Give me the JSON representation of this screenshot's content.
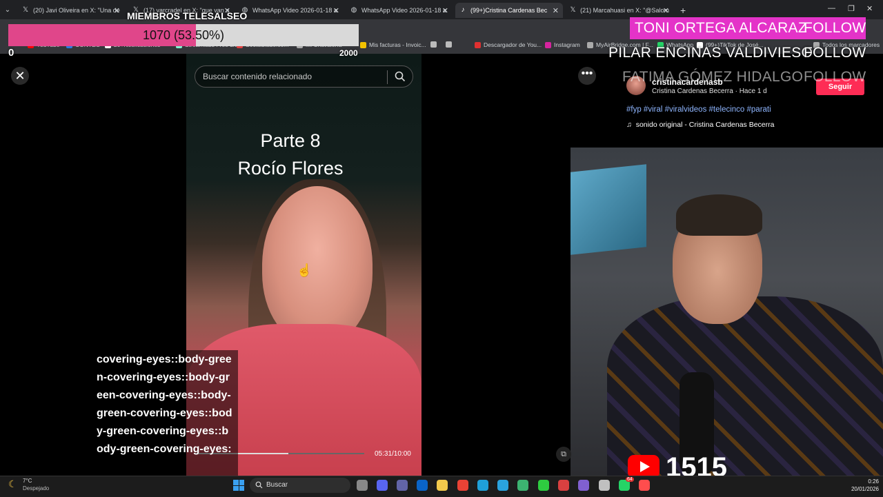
{
  "browser": {
    "tabs": [
      {
        "label": "(20) Javi Oliveira en X: \"Una de",
        "icon": "x-icon",
        "active": false
      },
      {
        "label": "(17) varcradel en X: \"que van a",
        "icon": "x-icon",
        "active": false
      },
      {
        "label": "WhatsApp Video 2026-01-18 a",
        "icon": "globe-icon",
        "active": false
      },
      {
        "label": "WhatsApp Video 2026-01-18 a",
        "icon": "globe-icon",
        "active": false
      },
      {
        "label": "(99+)Cristina Cardenas Bec",
        "icon": "tiktok-icon",
        "active": true
      },
      {
        "label": "(21) Marcahuasi en X: \"@Salom",
        "icon": "x-icon",
        "active": false
      }
    ],
    "new_tab": "+",
    "bookmarks": [
      {
        "label": "YouTube",
        "color": "#ff0000"
      },
      {
        "label": "CONTEO",
        "color": "#2a7ae2"
      },
      {
        "label": "20+Notificaciones",
        "color": "#ffffff"
      },
      {
        "label": "Streamlabs Free Liv...",
        "color": "#80f5d2"
      },
      {
        "label": "Socialblade.com",
        "color": "#e04040"
      },
      {
        "label": "Mi Chavalería",
        "color": "#aaaaaa"
      },
      {
        "label": "Mis facturas - Invoic...",
        "color": "#f2c200"
      },
      {
        "label": "",
        "color": "#bbbbbb"
      },
      {
        "label": "",
        "color": "#bbbbbb"
      },
      {
        "label": "Descargador de You...",
        "color": "#e03030"
      },
      {
        "label": "Instagram",
        "color": "#d6249f"
      },
      {
        "label": "MyAirBridge.com | F...",
        "color": "#aaaaaa"
      },
      {
        "label": "WhatsApp",
        "color": "#25d366"
      },
      {
        "label": "(99+)TikTok de José...",
        "color": "#ffffff"
      },
      {
        "label": "Todos los marcadores",
        "color": "#aaaaaa"
      }
    ]
  },
  "overlay": {
    "members_title": "MIEMBROS TELESALSEO",
    "goal_text": "1070 (53.50%)",
    "goal_fraction": 0.535,
    "goal_min": "0",
    "goal_max": "2000",
    "follows": [
      {
        "name": "TONI ORTEGA ALCARAZ",
        "action": "FOLLOW"
      },
      {
        "name": "PILAR ENCINAS VALDIVIESO",
        "action": "FOLLOW"
      },
      {
        "name": "FATIMA GÓMEZ HIDALGO",
        "action": "FOLLOW"
      }
    ],
    "chat_text": "covering-eyes::body-green-covering-eyes::body-green-covering-eyes::body-green-covering-eyes::body-green-covering-eyes::body-green-covering-eyes:",
    "youtube_count": "1515"
  },
  "tiktok": {
    "search_placeholder": "Buscar contenido relacionado",
    "caption_line1": "Parte 8",
    "caption_line2": "Rocío Flores",
    "timecode": "05:31/10:00",
    "progress_fraction": 0.553,
    "username": "cristinacardenasb",
    "meta": "Cristina Cardenas Becerra · Hace 1 d",
    "follow_label": "Seguir",
    "hashtags": "#fyp #viral #viralvideos #telecinco #parati",
    "sound": "sonido original - Cristina Cardenas Becerra"
  },
  "taskbar": {
    "weather_temp": "7°C",
    "weather_desc": "Despejado",
    "search_label": "Buscar",
    "time": "0:26",
    "date": "20/01/2026",
    "notification_badge": "64"
  }
}
